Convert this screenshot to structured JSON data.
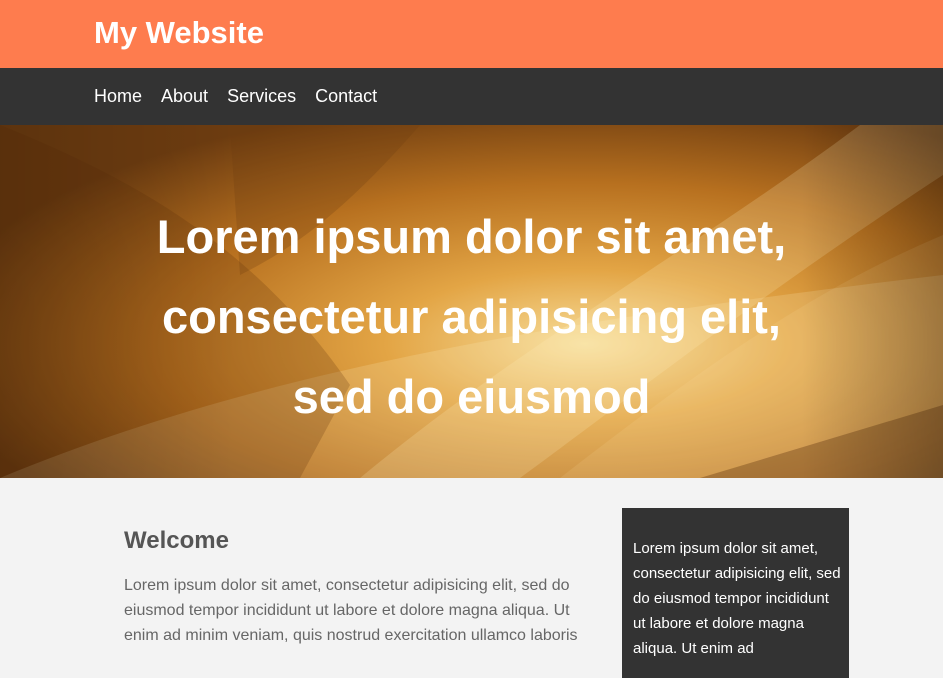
{
  "header": {
    "site_title": "My Website",
    "background_color": "#fe7c4e"
  },
  "nav": {
    "background_color": "#333333",
    "items": [
      {
        "label": "Home"
      },
      {
        "label": "About"
      },
      {
        "label": "Services"
      },
      {
        "label": "Contact"
      }
    ]
  },
  "hero": {
    "line1": "Lorem ipsum dolor sit amet,",
    "line2": "consectetur adipisicing elit,",
    "line3": "sed do eiusmod"
  },
  "main": {
    "title": "Welcome",
    "body": "Lorem ipsum dolor sit amet, consectetur adipisicing elit, sed do eiusmod tempor incididunt ut labore et dolore magna aliqua. Ut enim ad minim veniam, quis nostrud exercitation ullamco laboris"
  },
  "sidebar": {
    "text": "Lorem ipsum dolor sit amet, consectetur adipisicing elit, sed do eiusmod tempor incididunt ut labore et dolore magna aliqua. Ut enim ad"
  }
}
